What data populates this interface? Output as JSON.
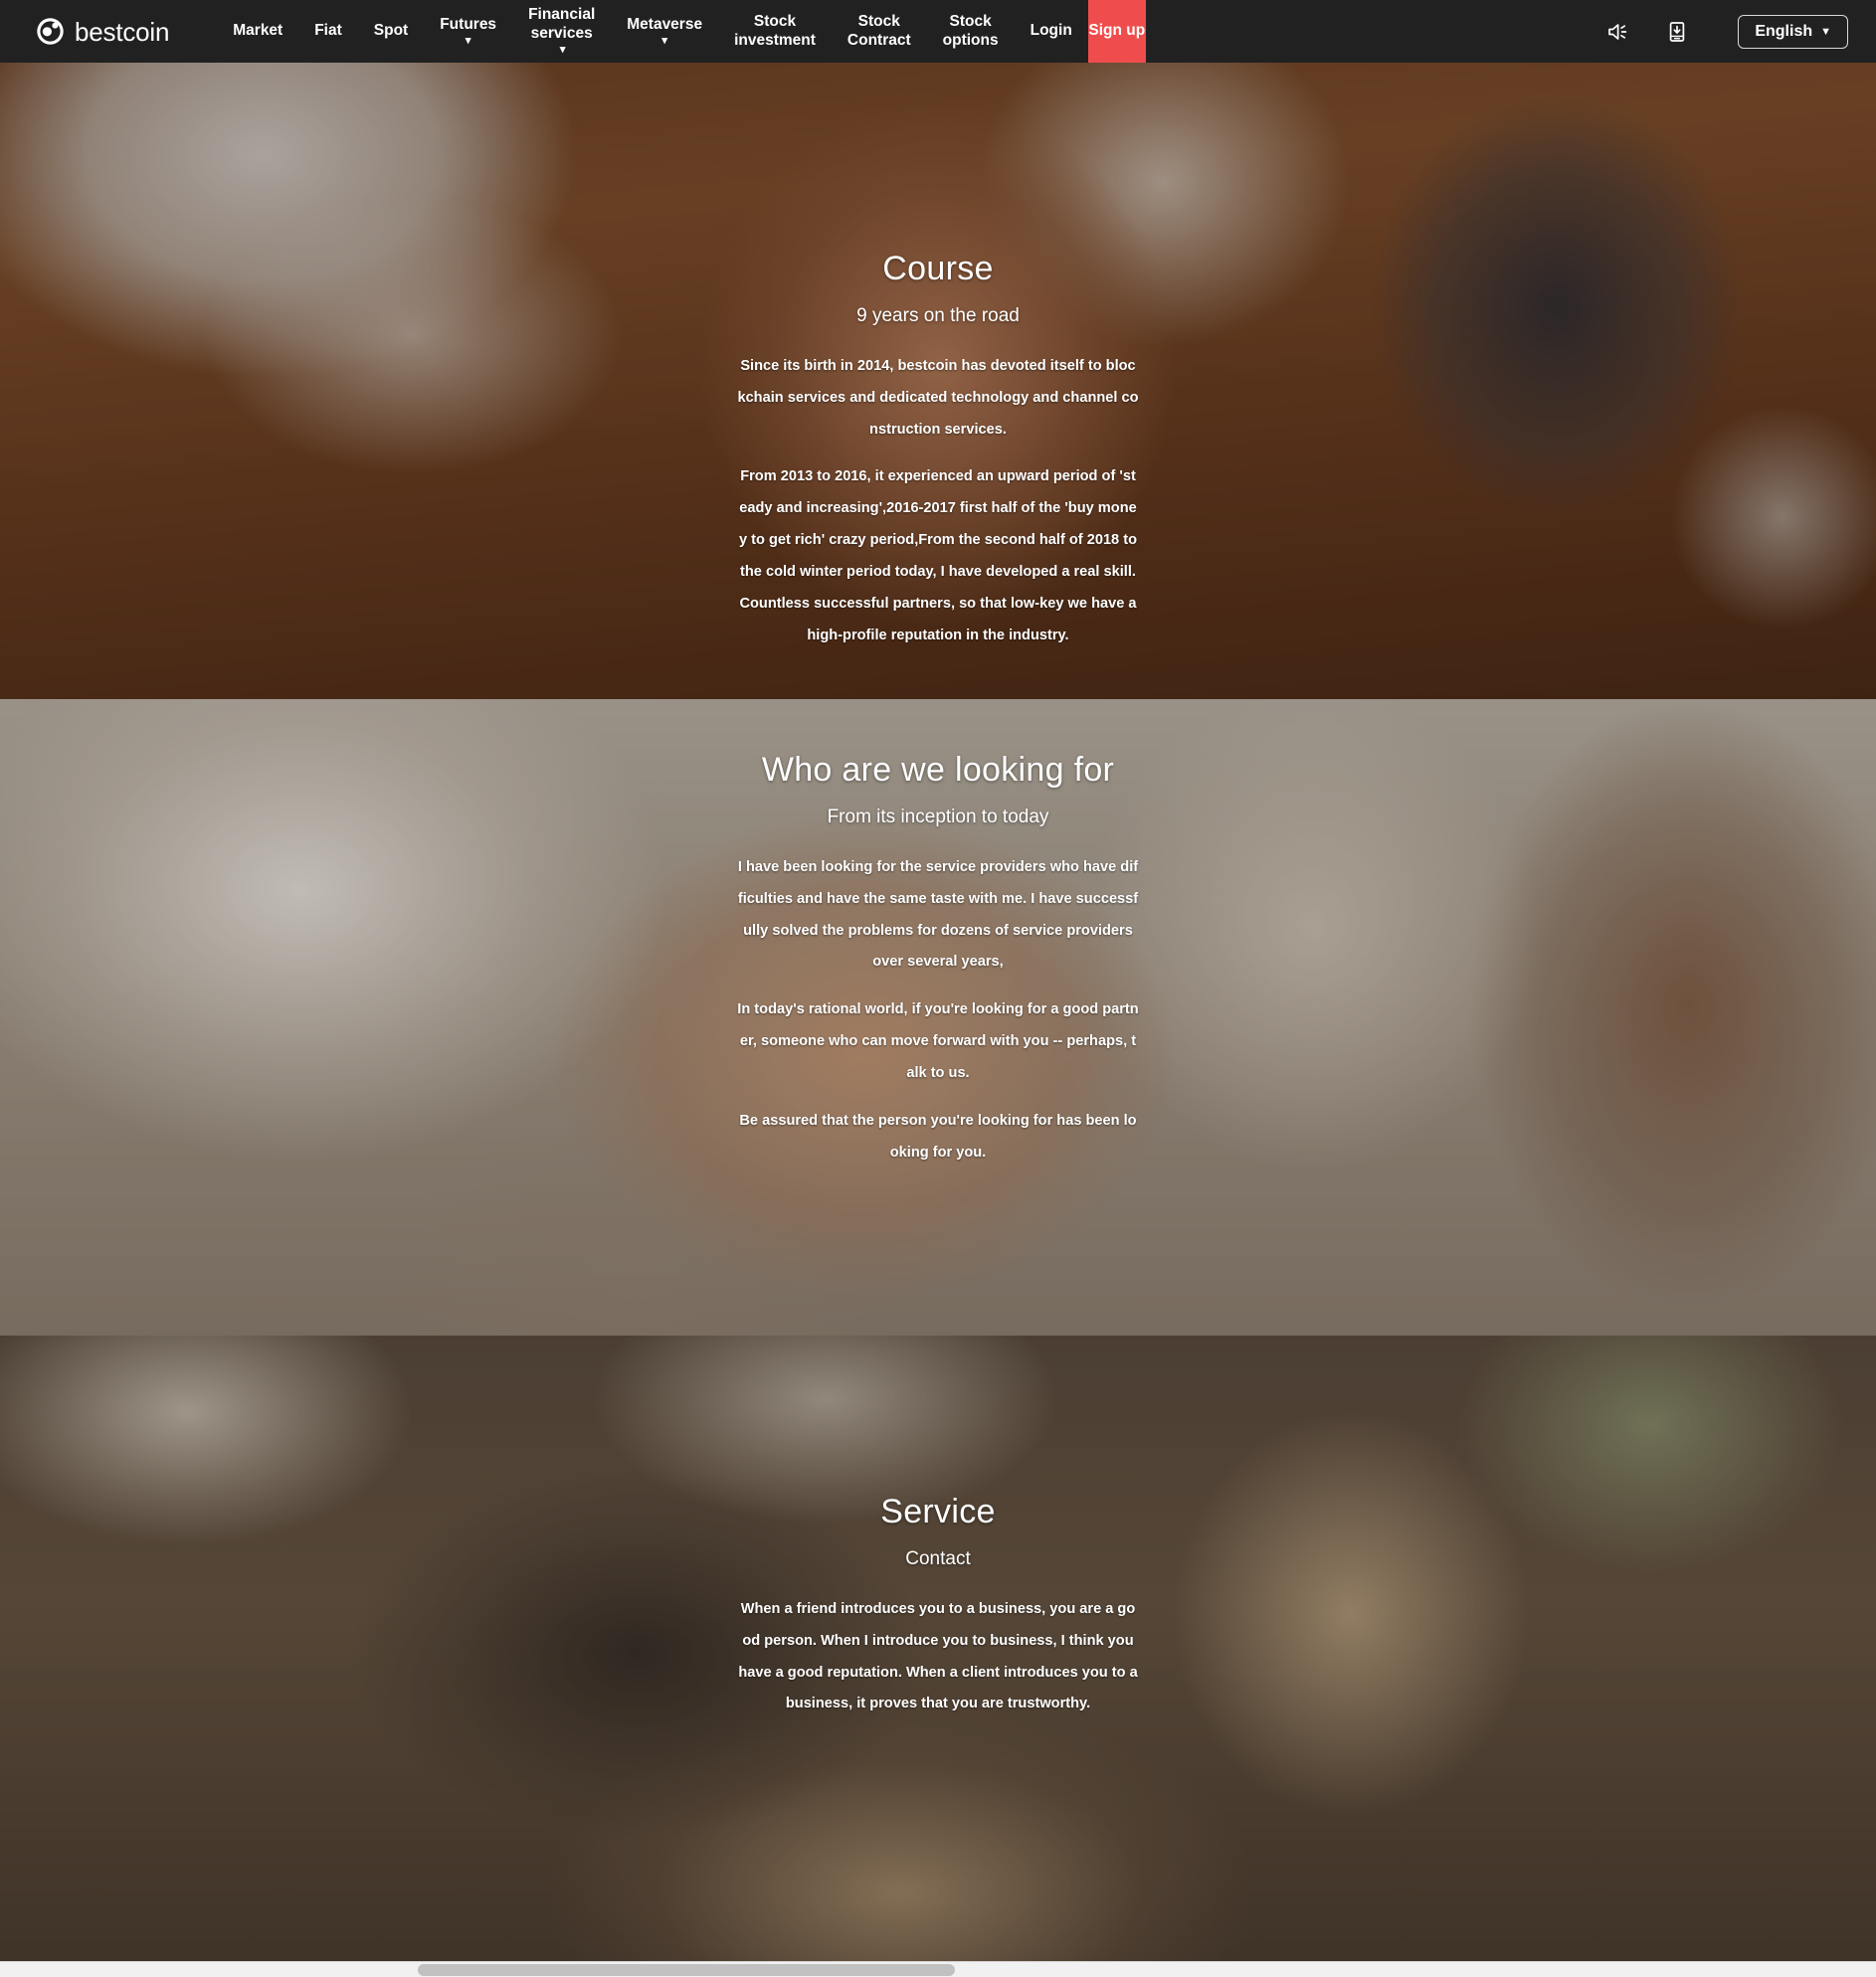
{
  "navbar": {
    "brand": {
      "name": "bestcoin",
      "logo_icon": "bestcoin-logo-icon"
    },
    "items": [
      {
        "label": "Market",
        "caret": false
      },
      {
        "label": "Fiat",
        "caret": false
      },
      {
        "label": "Spot",
        "caret": false
      },
      {
        "label": "Futures",
        "caret": "below"
      },
      {
        "label": "Financial\nservices",
        "caret": "inline"
      },
      {
        "label": "Metaverse",
        "caret": "below"
      },
      {
        "label": "Stock\ninvestment",
        "caret": false
      },
      {
        "label": "Stock\nContract",
        "caret": false
      },
      {
        "label": "Stock\noptions",
        "caret": false
      },
      {
        "label": "Login",
        "caret": false
      }
    ],
    "signup_label": "Sign up",
    "signup_color": "#ef4d4d",
    "icons": [
      {
        "name": "announcement-speaker-icon"
      },
      {
        "name": "download-app-icon"
      }
    ],
    "language": {
      "label": "English",
      "caret": "▼"
    },
    "background_color": "#212121"
  },
  "sections": [
    {
      "id": "course",
      "title": "Course",
      "subtitle": "9 years on the road",
      "paragraphs": [
        "Since its birth in 2014, bestcoin has devoted itself to blockchain services and dedicated technology and channel construction services.",
        "From 2013 to 2016, it experienced an upward period of 'steady and increasing',2016-2017 first half of the 'buy money to get rich' crazy period,From the second half of 2018 to the cold winter period today, I have developed a real skill.Countless successful partners, so that low-key we have a high-profile reputation in the industry."
      ]
    },
    {
      "id": "who",
      "title": "Who are we looking for",
      "subtitle": "From its inception to today",
      "paragraphs": [
        "I have been looking for the service providers who have difficulties and have the same taste with me. I have successfully solved the problems for dozens of service providers over several years,",
        "In today's rational world, if you're looking for a good partner, someone who can move forward with you -- perhaps, talk to us.",
        "Be assured that the person you're looking for has been looking for you."
      ]
    },
    {
      "id": "service",
      "title": "Service",
      "subtitle": "Contact",
      "paragraphs": [
        "When a friend introduces you to a business, you are a good person. When I introduce you to business, I think you have a good reputation. When a client introduces you to a business, it proves that you are trustworthy."
      ]
    }
  ],
  "scrollbar": {
    "orientation": "horizontal",
    "track_color": "#f1f1f1",
    "thumb_color": "#c1c1c1"
  }
}
